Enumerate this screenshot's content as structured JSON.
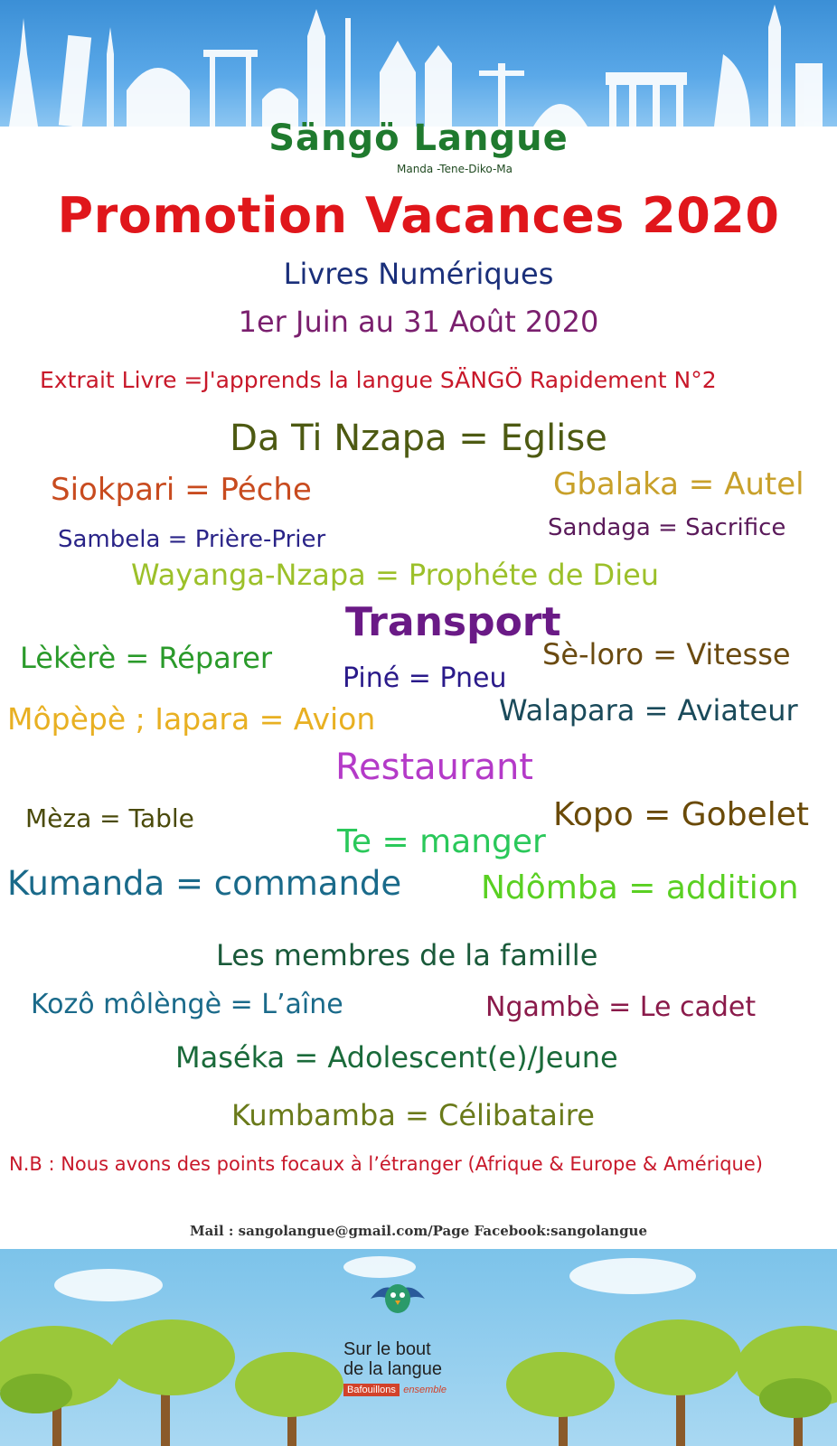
{
  "brand": {
    "name": "Sängö Langue",
    "tagline": "Manda -Tene-Diko-Ma"
  },
  "promo": {
    "title": "Promotion Vacances 2020",
    "subtitle": "Livres Numériques",
    "dates": "1er Juin au 31 Août 2020",
    "extract": "Extrait Livre =J'apprends la langue SÄNGÖ Rapidement N°2"
  },
  "church": {
    "heading": "Da Ti Nzapa = Eglise",
    "siokpari": "Siokpari = Péche",
    "gbalaka": "Gbalaka = Autel",
    "sambela": "Sambela = Prière-Prier",
    "sandaga": "Sandaga = Sacrifice",
    "wayanga": "Wayanga-Nzapa = Prophéte de Dieu"
  },
  "transport": {
    "heading": "Transport",
    "lekere": "Lèkèrè = Réparer",
    "seloro": "Sè-loro = Vitesse",
    "pine": "Piné = Pneu",
    "mopepe": "Môpèpè ; Iapara = Avion",
    "walapara": "Walapara = Aviateur"
  },
  "restaurant": {
    "heading": "Restaurant",
    "meza": "Mèza = Table",
    "kopo": "Kopo = Gobelet",
    "te": "Te = manger",
    "kumanda": "Kumanda  = commande",
    "ndomba": "Ndômba = addition"
  },
  "family": {
    "heading": "Les membres de la famille",
    "kozo": "Kozô môlèngè = L’aîne",
    "ngambe": "Ngambè = Le cadet",
    "maseka": "Maséka = Adolescent(e)/Jeune",
    "kumbamba": "Kumbamba = Célibataire"
  },
  "note": "N.B : Nous avons des points focaux à l’étranger (Afrique & Europe & Amérique)",
  "contact": "Mail : sangolangue@gmail.com/Page Facebook:sangolangue",
  "partner": {
    "line1": "Sur le bout",
    "line2": "de la langue",
    "badge": "Bafouillons",
    "badge_suffix": "ensemble"
  },
  "colors": {
    "brand_green": "#1f7a2e",
    "title_red": "#e0161b",
    "navy": "#1a2f7a",
    "purple": "#7a1f6e",
    "crimson": "#c8182a"
  }
}
